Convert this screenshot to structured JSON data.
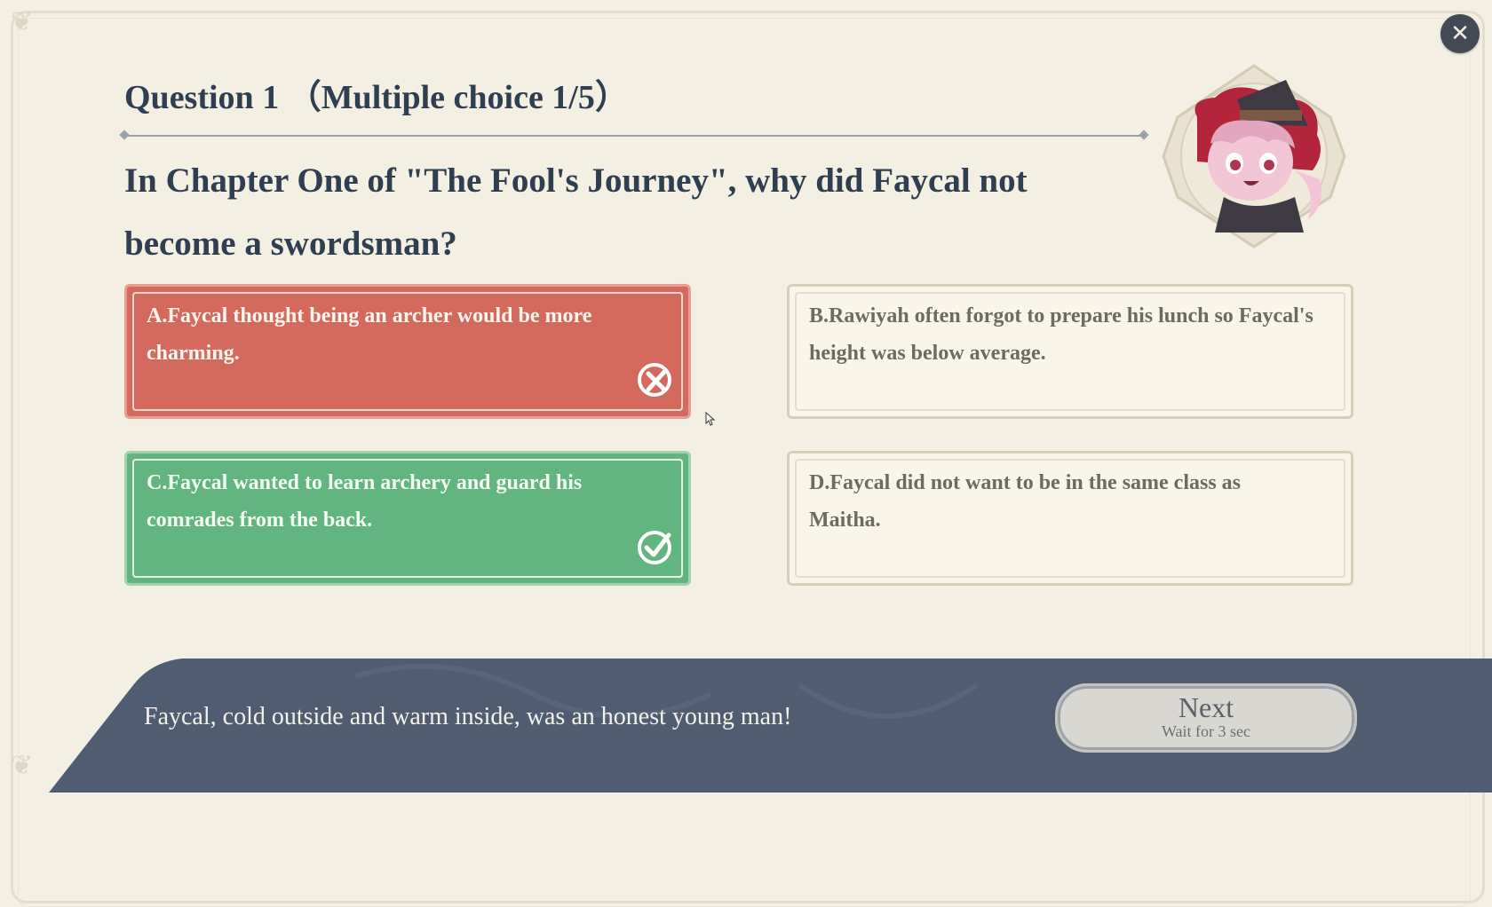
{
  "quiz": {
    "title": "Question 1 （Multiple choice 1/5）",
    "question": "In Chapter One of \"The Fool's Journey\", why did Faycal not become a swordsman?",
    "options": [
      {
        "letter": "A.",
        "text": "Faycal thought being an archer would be more charming.",
        "state": "wrong",
        "mark": "cross-mark-icon"
      },
      {
        "letter": "B.",
        "text": "Rawiyah often forgot to prepare his lunch so Faycal's height was below average.",
        "state": "unselected"
      },
      {
        "letter": "C.",
        "text": "Faycal wanted to learn archery and guard his comrades from the back.",
        "state": "correct",
        "mark": "check-mark-icon"
      },
      {
        "letter": "D.",
        "text": "Faycal did not want to be in the same class as Maitha.",
        "state": "unselected"
      }
    ]
  },
  "feedback": {
    "hint": "Faycal, cold outside and warm inside, was an honest young man!"
  },
  "next_button": {
    "label": "Next",
    "sublabel": "Wait for 3 sec"
  },
  "icons": {
    "close": "close-icon",
    "avatar": "witch-character-avatar"
  },
  "colors": {
    "wrong": "#d46a5e",
    "correct": "#62b57e",
    "neutral": "#f9f5e9",
    "title": "#2f3e50",
    "bottom_bar": "#4f5c72"
  }
}
